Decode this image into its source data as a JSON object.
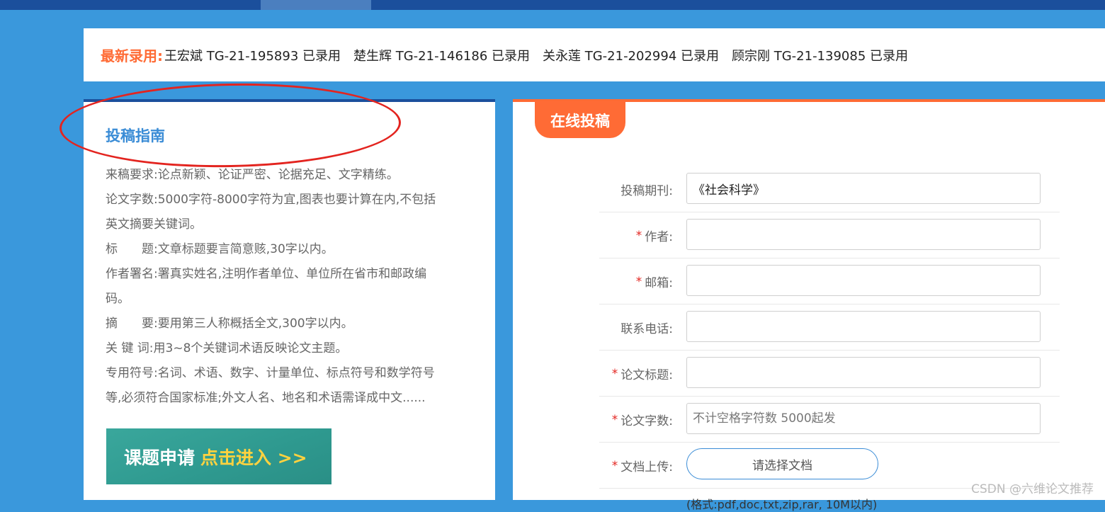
{
  "ticker": {
    "label": "最新录用:",
    "items": [
      "王宏斌 TG-21-195893 已录用",
      "楚生辉 TG-21-146186 已录用",
      "关永莲 TG-21-202994 已录用",
      "顾宗刚 TG-21-139085 已录用"
    ]
  },
  "guide": {
    "title": "投稿指南",
    "lines": [
      "来稿要求:论点新颖、论证严密、论据充足、文字精练。",
      "论文字数:5000字符-8000字符为宜,图表也要计算在内,不包括",
      "英文摘要关键词。",
      "标　　题:文章标题要言简意赅,30字以内。",
      "作者署名:署真实姓名,注明作者单位、单位所在省市和邮政编",
      "码。",
      "摘　　要:要用第三人称概括全文,300字以内。",
      "关 键 词:用3~8个关键词术语反映论文主题。",
      "专用符号:名词、术语、数字、计量单位、标点符号和数学符号",
      "等,必须符合国家标准;外文人名、地名和术语需译成中文......"
    ],
    "banner": {
      "main": "课题申请",
      "cta": "点击进入 >>"
    }
  },
  "form": {
    "title": "在线投稿",
    "fields": {
      "journal": {
        "label": "投稿期刊:",
        "value": "《社会科学》",
        "required": false
      },
      "author": {
        "label": "作者:",
        "value": "",
        "required": true
      },
      "email": {
        "label": "邮箱:",
        "value": "",
        "required": true
      },
      "phone": {
        "label": "联系电话:",
        "value": "",
        "required": false
      },
      "paper_title": {
        "label": "论文标题:",
        "value": "",
        "required": true
      },
      "word_count": {
        "label": "论文字数:",
        "placeholder": "不计空格字符数 5000起发",
        "required": true
      },
      "upload": {
        "label": "文档上传:",
        "button": "请选择文档",
        "required": true
      }
    },
    "format_note": "(格式:pdf,doc,txt,zip,rar, 10M以内)"
  },
  "required_mark": "*",
  "watermark": "CSDN @六维论文推荐",
  "colors": {
    "page_bg": "#3a98dc",
    "top_bar": "#1b4f9c",
    "accent_orange": "#ff6b35",
    "title_blue": "#3a8cd6",
    "banner_teal": "#2f9a90",
    "banner_cta": "#ffd23f",
    "annotation_red": "#e3241f"
  }
}
